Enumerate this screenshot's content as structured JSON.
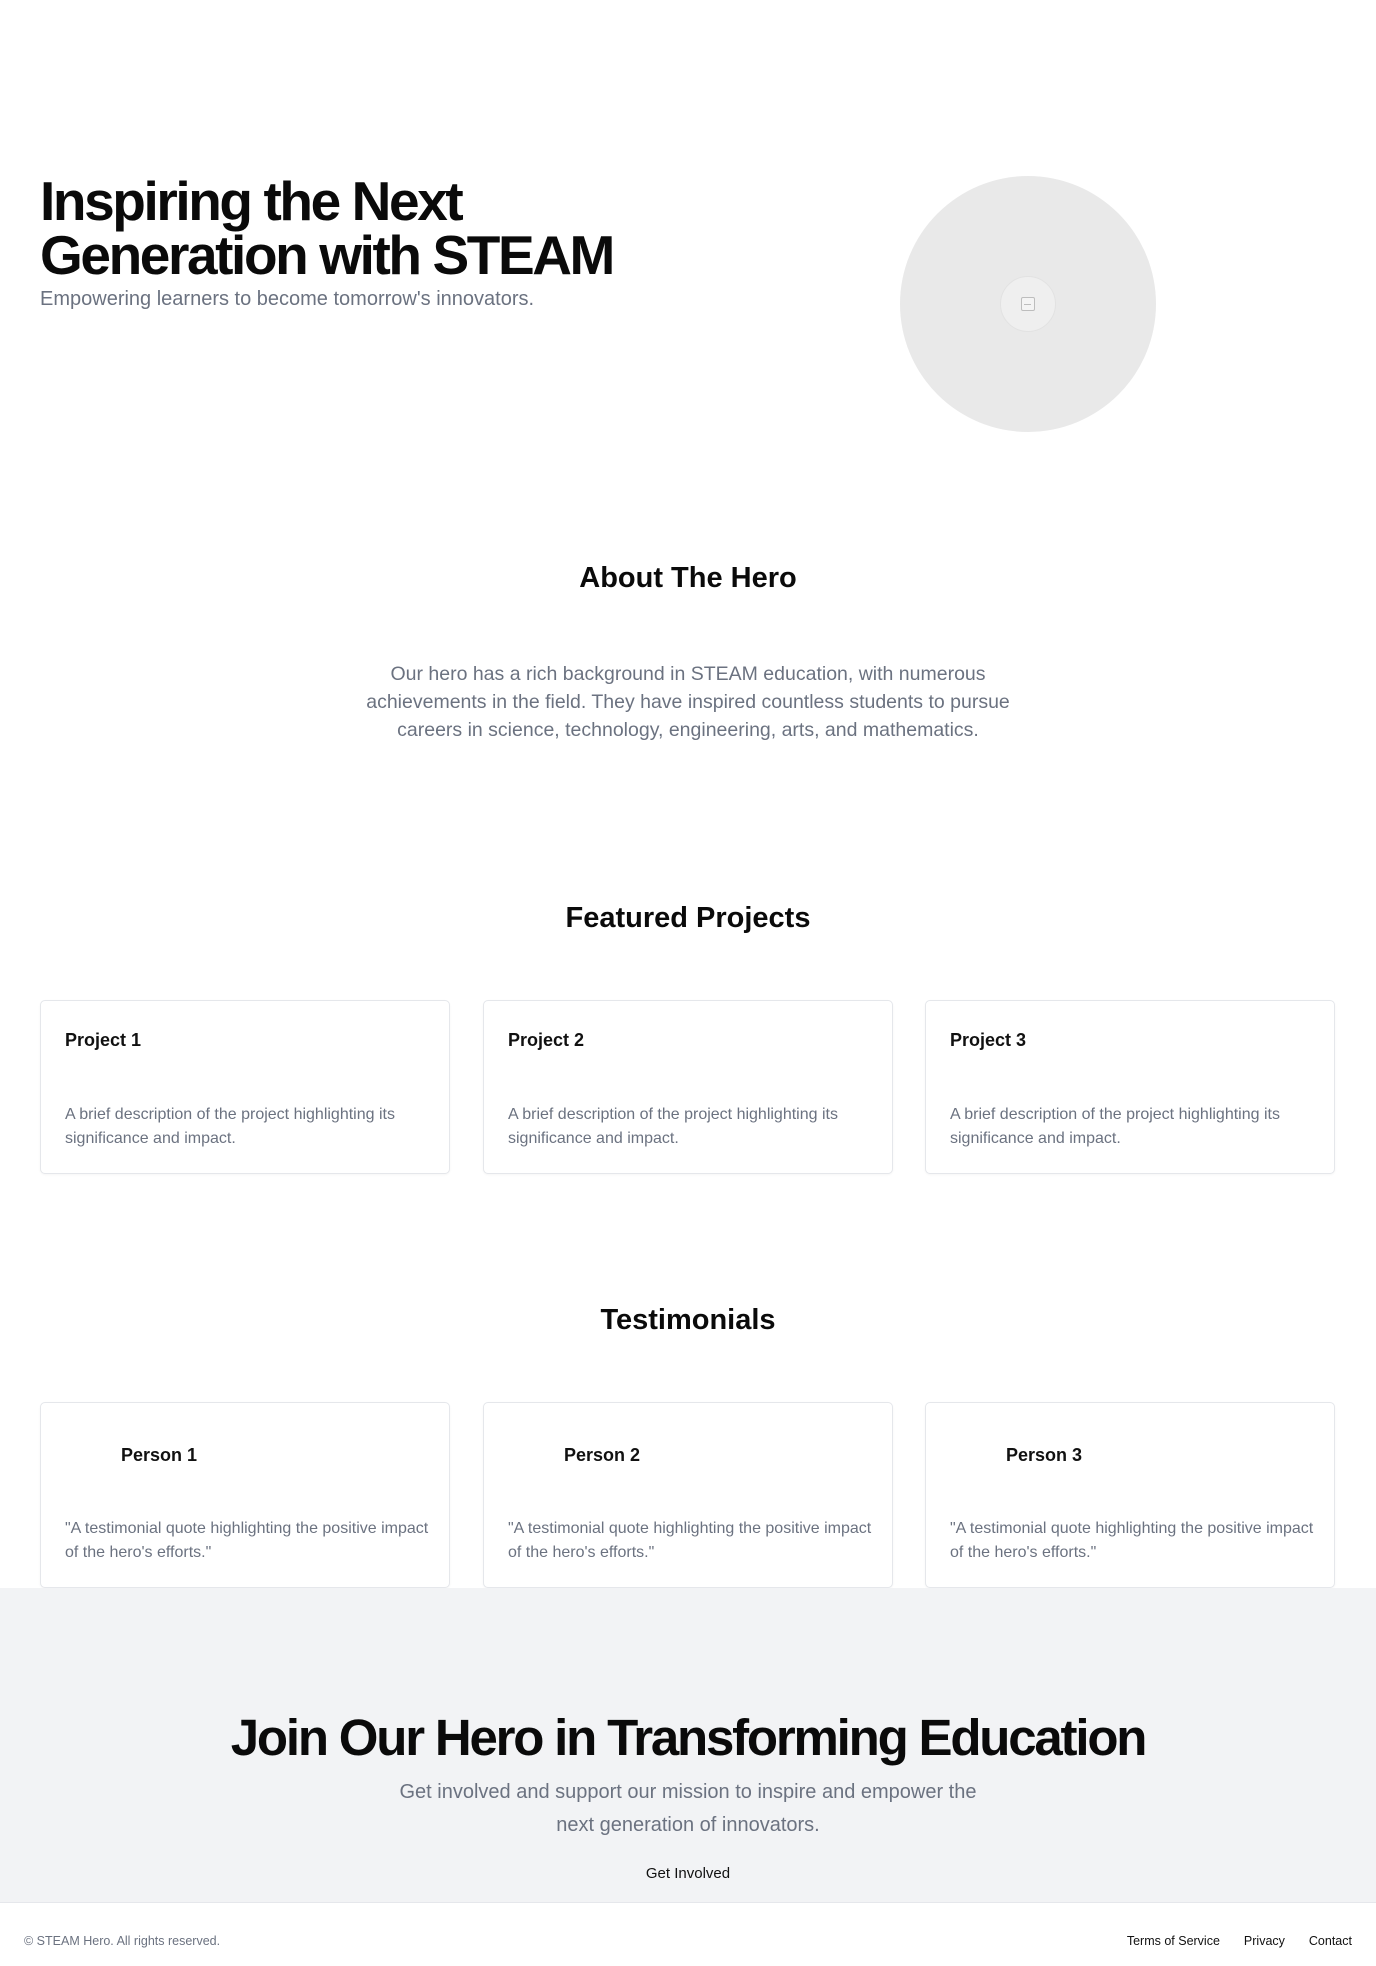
{
  "hero": {
    "title": "Inspiring the Next Generation with STEAM",
    "subtitle": "Empowering learners to become tomorrow's innovators.",
    "image_icon": "image-placeholder-icon"
  },
  "about": {
    "title": "About The Hero",
    "text": "Our hero has a rich background in STEAM education, with numerous achievements in the field. They have inspired countless students to pursue careers in science, technology, engineering, arts, and mathematics."
  },
  "projects": {
    "title": "Featured Projects",
    "items": [
      {
        "title": "Project 1",
        "description": "A brief description of the project highlighting its significance and impact."
      },
      {
        "title": "Project 2",
        "description": "A brief description of the project highlighting its significance and impact."
      },
      {
        "title": "Project 3",
        "description": "A brief description of the project highlighting its significance and impact."
      }
    ]
  },
  "testimonials": {
    "title": "Testimonials",
    "items": [
      {
        "name": "Person 1",
        "quote": "\"A testimonial quote highlighting the positive impact of the hero's efforts.\""
      },
      {
        "name": "Person 2",
        "quote": "\"A testimonial quote highlighting the positive impact of the hero's efforts.\""
      },
      {
        "name": "Person 3",
        "quote": "\"A testimonial quote highlighting the positive impact of the hero's efforts.\""
      }
    ]
  },
  "cta": {
    "title": "Join Our Hero in Transforming Education",
    "subtitle": "Get involved and support our mission to inspire and empower the next generation of innovators.",
    "button_label": "Get Involved"
  },
  "footer": {
    "copyright": "© STEAM Hero. All rights reserved.",
    "links": [
      "Terms of Service",
      "Privacy",
      "Contact"
    ]
  },
  "colors": {
    "heading": "#0a0a0a",
    "muted_text": "#6b7280",
    "cta_background": "#f2f3f5",
    "card_border": "#e5e7eb",
    "placeholder_circle": "#e9e9e9"
  }
}
